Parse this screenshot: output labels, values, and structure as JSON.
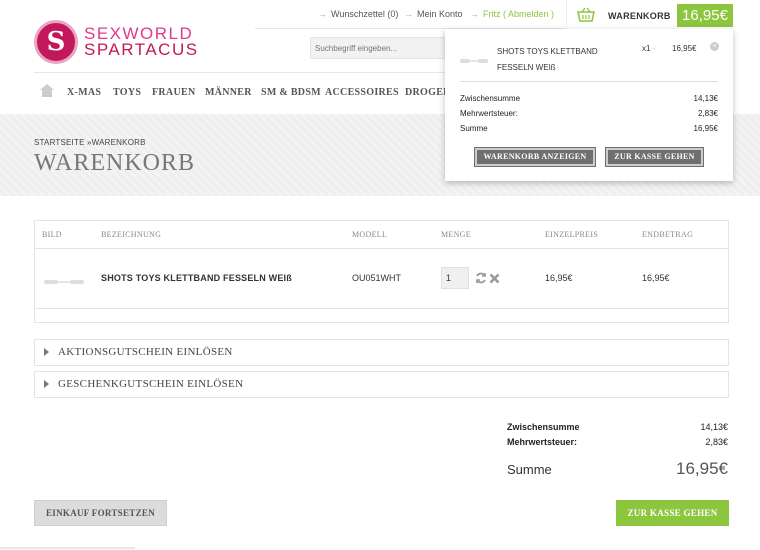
{
  "brand": {
    "logo_letter": "S",
    "line1": "SEXWORLD",
    "line2": "SPARTACUS"
  },
  "toplinks": {
    "wishlist": "Wunschzettel (0)",
    "account": "Mein Konto",
    "user": "Fritz",
    "logout": "( Abmelden )"
  },
  "search": {
    "placeholder": "Suchbegriff eingeben..."
  },
  "cart": {
    "label": "WARENKORB",
    "total": "16,95€"
  },
  "nav": [
    "X-MAS",
    "TOYS",
    "FRAUEN",
    "MÄNNER",
    "SM & BDSM",
    "ACCESSOIRES",
    "DROGERIE"
  ],
  "breadcrumb": "STARTSEITE »WARENKORB",
  "page_title": "WARENKORB",
  "dropdown": {
    "item_name": "SHOTS TOYS KLETTBAND FESSELN WEIß",
    "qty": "x1",
    "qty_sep": "-",
    "price": "16,95€",
    "close": "×",
    "rows": [
      {
        "label": "Zwischensumme",
        "value": "14,13€"
      },
      {
        "label": "Mehrwertsteuer:",
        "value": "2,83€"
      },
      {
        "label": "Summe",
        "value": "16,95€"
      }
    ],
    "btn_view": "WARENKORB ANZEIGEN",
    "btn_checkout": "ZUR KASSE GEHEN"
  },
  "table": {
    "headers": [
      "BILD",
      "BEZEICHNUNG",
      "MODELL",
      "MENGE",
      "EINZELPREIS",
      "ENDBETRAG"
    ],
    "rows": [
      {
        "name": "SHOTS TOYS KLETTBAND FESSELN WEIß",
        "model": "OU051WHT",
        "qty": "1",
        "unit_price": "16,95€",
        "total": "16,95€"
      }
    ]
  },
  "coupons": {
    "promo": "AKTIONSGUTSCHEIN EINLÖSEN",
    "gift": "GESCHENKGUTSCHEIN EINLÖSEN"
  },
  "totals": {
    "subtotal_label": "Zwischensumme",
    "subtotal": "14,13€",
    "tax_label": "Mehrwertsteuer:",
    "tax": "2,83€",
    "sum_label": "Summe",
    "sum": "16,95€"
  },
  "buttons": {
    "continue": "EINKAUF FORTSETZEN",
    "checkout": "ZUR KASSE GEHEN"
  },
  "colors": {
    "accent": "#8cc63f",
    "brand": "#c2185b"
  }
}
